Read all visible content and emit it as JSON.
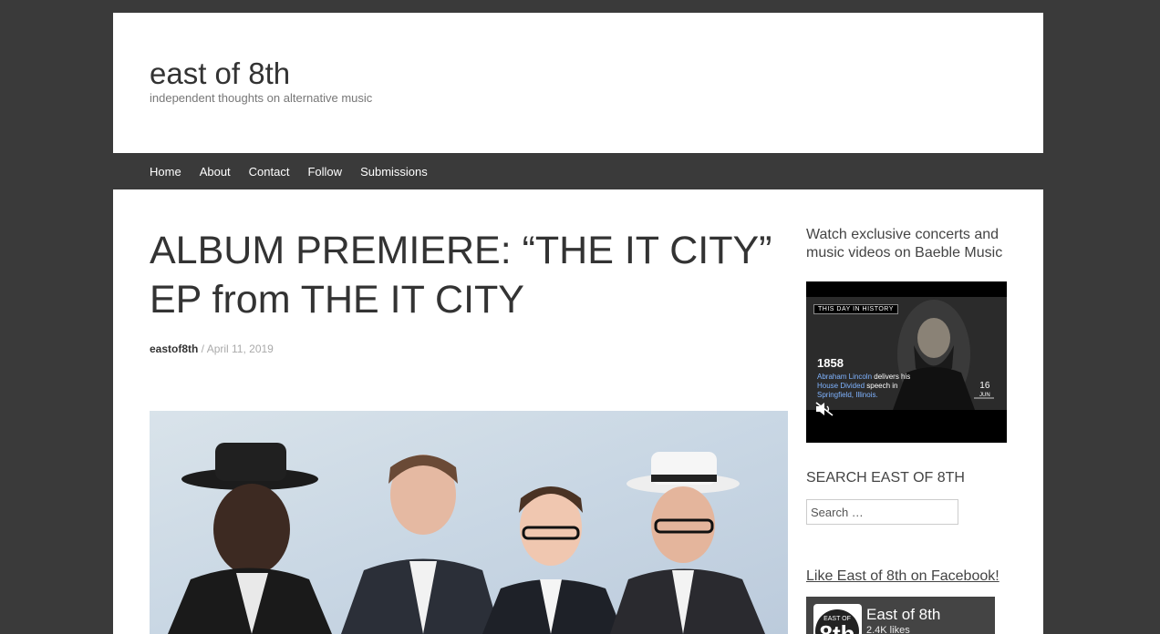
{
  "site": {
    "title": "east of 8th",
    "description": "independent thoughts on alternative music"
  },
  "nav": {
    "items": [
      "Home",
      "About",
      "Contact",
      "Follow",
      "Submissions"
    ]
  },
  "post": {
    "title": "ALBUM PREMIERE: “THE IT CITY” EP from THE IT CITY",
    "author": "eastof8th",
    "separator": " / ",
    "date": "April 11, 2019"
  },
  "sidebar": {
    "baeble_text": "Watch exclusive concerts and music videos on Baeble Music",
    "video": {
      "banner": "THIS DAY IN HISTORY",
      "year": "1858",
      "caption_name": "Abraham Lincoln",
      "caption_1": " delivers his ",
      "caption_2": "House Divided",
      "caption_3": " speech in ",
      "caption_4": "Springfield, Illinois.",
      "day": "16",
      "month": "JUN"
    },
    "search_heading": "SEARCH EAST OF 8TH",
    "search_placeholder": "Search …",
    "facebook_link": "Like East of 8th on Facebook!",
    "facebook_page_name": "East of 8th",
    "facebook_likes": "2.4K likes"
  },
  "colors": {
    "background": "#3a3a3a",
    "page": "#ffffff",
    "navbar": "#3a3a3a",
    "title_text": "#333333"
  }
}
